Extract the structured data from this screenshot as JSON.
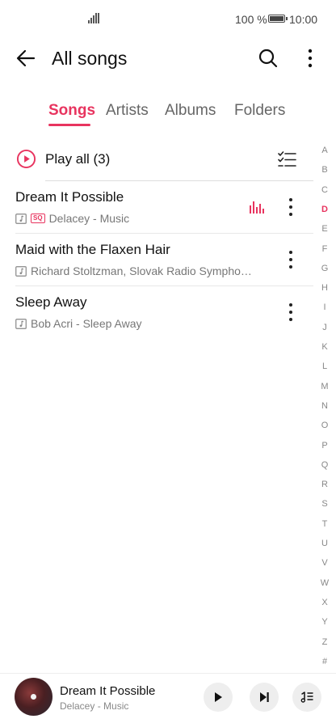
{
  "status_bar": {
    "battery_text": "100 %",
    "time": "10:00"
  },
  "header": {
    "title": "All songs"
  },
  "tabs": [
    {
      "label": "Songs",
      "active": true
    },
    {
      "label": "Artists",
      "active": false
    },
    {
      "label": "Albums",
      "active": false
    },
    {
      "label": "Folders",
      "active": false
    }
  ],
  "play_all": {
    "label": "Play all (3)"
  },
  "songs": [
    {
      "title": "Dream It Possible",
      "subtitle": "Delacey - Music",
      "badge": "SQ",
      "playing": true
    },
    {
      "title": "Maid with the Flaxen Hair",
      "subtitle": "Richard Stoltzman, Slovak Radio Sympho…",
      "badge": "",
      "playing": false
    },
    {
      "title": "Sleep Away",
      "subtitle": "Bob Acri - Sleep Away",
      "badge": "",
      "playing": false
    }
  ],
  "alpha_index": [
    "A",
    "B",
    "C",
    "D",
    "E",
    "F",
    "G",
    "H",
    "I",
    "J",
    "K",
    "L",
    "M",
    "N",
    "O",
    "P",
    "Q",
    "R",
    "S",
    "T",
    "U",
    "V",
    "W",
    "X",
    "Y",
    "Z",
    "#"
  ],
  "alpha_active": "D",
  "now_playing": {
    "title": "Dream It Possible",
    "artist": "Delacey - Music"
  },
  "colors": {
    "accent": "#e8345f",
    "text": "#111111",
    "secondary": "#777777"
  },
  "icons": {
    "back": "arrow-left-icon",
    "search": "search-icon",
    "more": "more-vertical-icon",
    "play_all": "play-circle-icon",
    "multiselect": "checklist-icon",
    "equalizer": "equalizer-icon",
    "play": "play-icon",
    "next": "skip-next-icon",
    "queue": "playlist-icon"
  }
}
